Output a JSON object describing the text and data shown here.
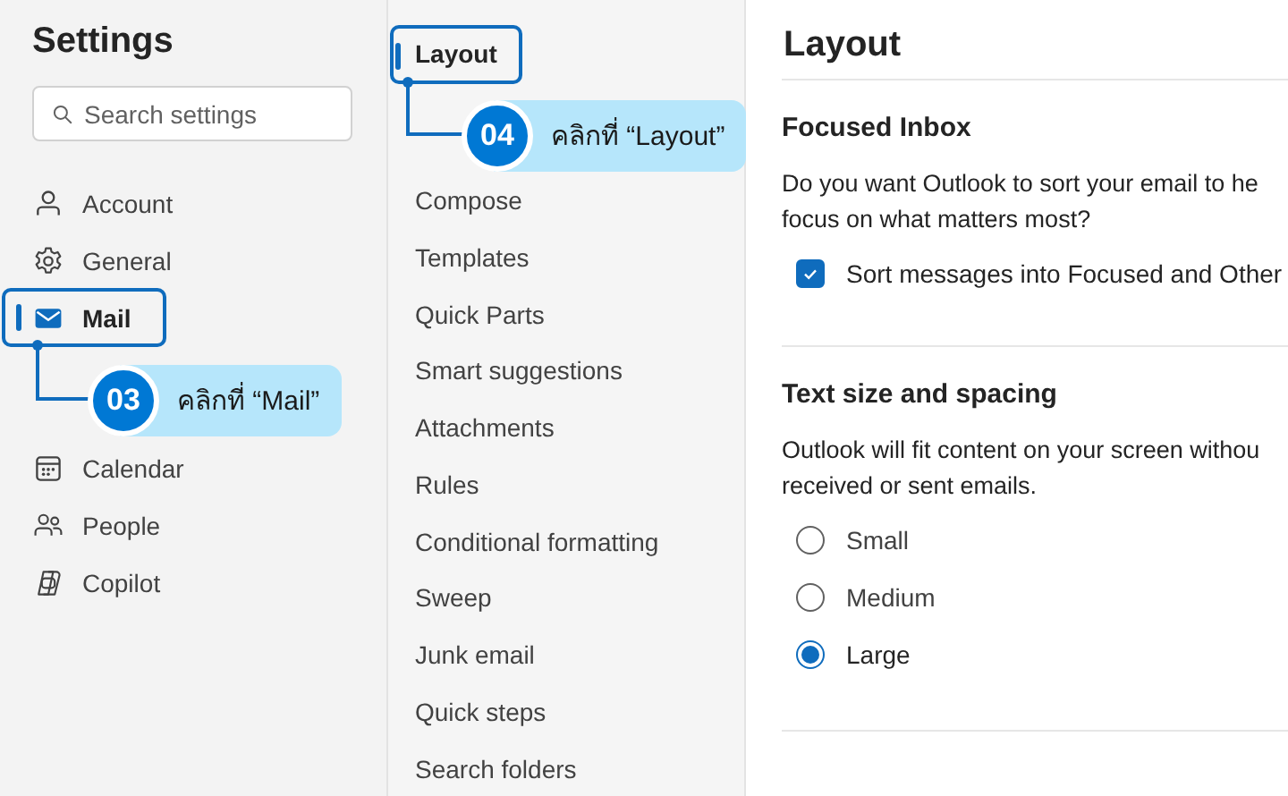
{
  "nav": {
    "title": "Settings",
    "search": {
      "placeholder": "Search settings"
    },
    "items": [
      {
        "label": "Account",
        "selected": false
      },
      {
        "label": "General",
        "selected": false
      },
      {
        "label": "Mail",
        "selected": true,
        "callout": {
          "number": "03",
          "text": "คลิกที่ “Mail”"
        }
      },
      {
        "label": "Calendar",
        "selected": false
      },
      {
        "label": "People",
        "selected": false
      },
      {
        "label": "Copilot",
        "selected": false
      }
    ]
  },
  "submenu": {
    "items": [
      {
        "label": "Layout",
        "selected": true,
        "callout": {
          "number": "04",
          "text": "คลิกที่ “Layout”"
        }
      },
      {
        "label": "Compose",
        "selected": false
      },
      {
        "label": "Templates",
        "selected": false
      },
      {
        "label": "Quick Parts",
        "selected": false
      },
      {
        "label": "Smart suggestions",
        "selected": false
      },
      {
        "label": "Attachments",
        "selected": false
      },
      {
        "label": "Rules",
        "selected": false
      },
      {
        "label": "Conditional formatting",
        "selected": false
      },
      {
        "label": "Sweep",
        "selected": false
      },
      {
        "label": "Junk email",
        "selected": false
      },
      {
        "label": "Quick steps",
        "selected": false
      },
      {
        "label": "Search folders",
        "selected": false
      }
    ]
  },
  "content": {
    "title": "Layout",
    "sections": [
      {
        "heading": "Focused Inbox",
        "lines": [
          "Do you want Outlook to sort your email to he",
          "focus on what matters most?"
        ],
        "options": [
          {
            "kind": "checkbox",
            "label": "Sort messages into Focused and Other",
            "checked": true
          }
        ]
      },
      {
        "heading": "Text size and spacing",
        "lines": [
          "Outlook will fit content on your screen withou",
          "received or sent emails."
        ],
        "options": [
          {
            "kind": "radio",
            "label": "Small",
            "selected": false
          },
          {
            "kind": "radio",
            "label": "Medium",
            "selected": false
          },
          {
            "kind": "radio",
            "label": "Large",
            "selected": true
          }
        ]
      }
    ]
  }
}
